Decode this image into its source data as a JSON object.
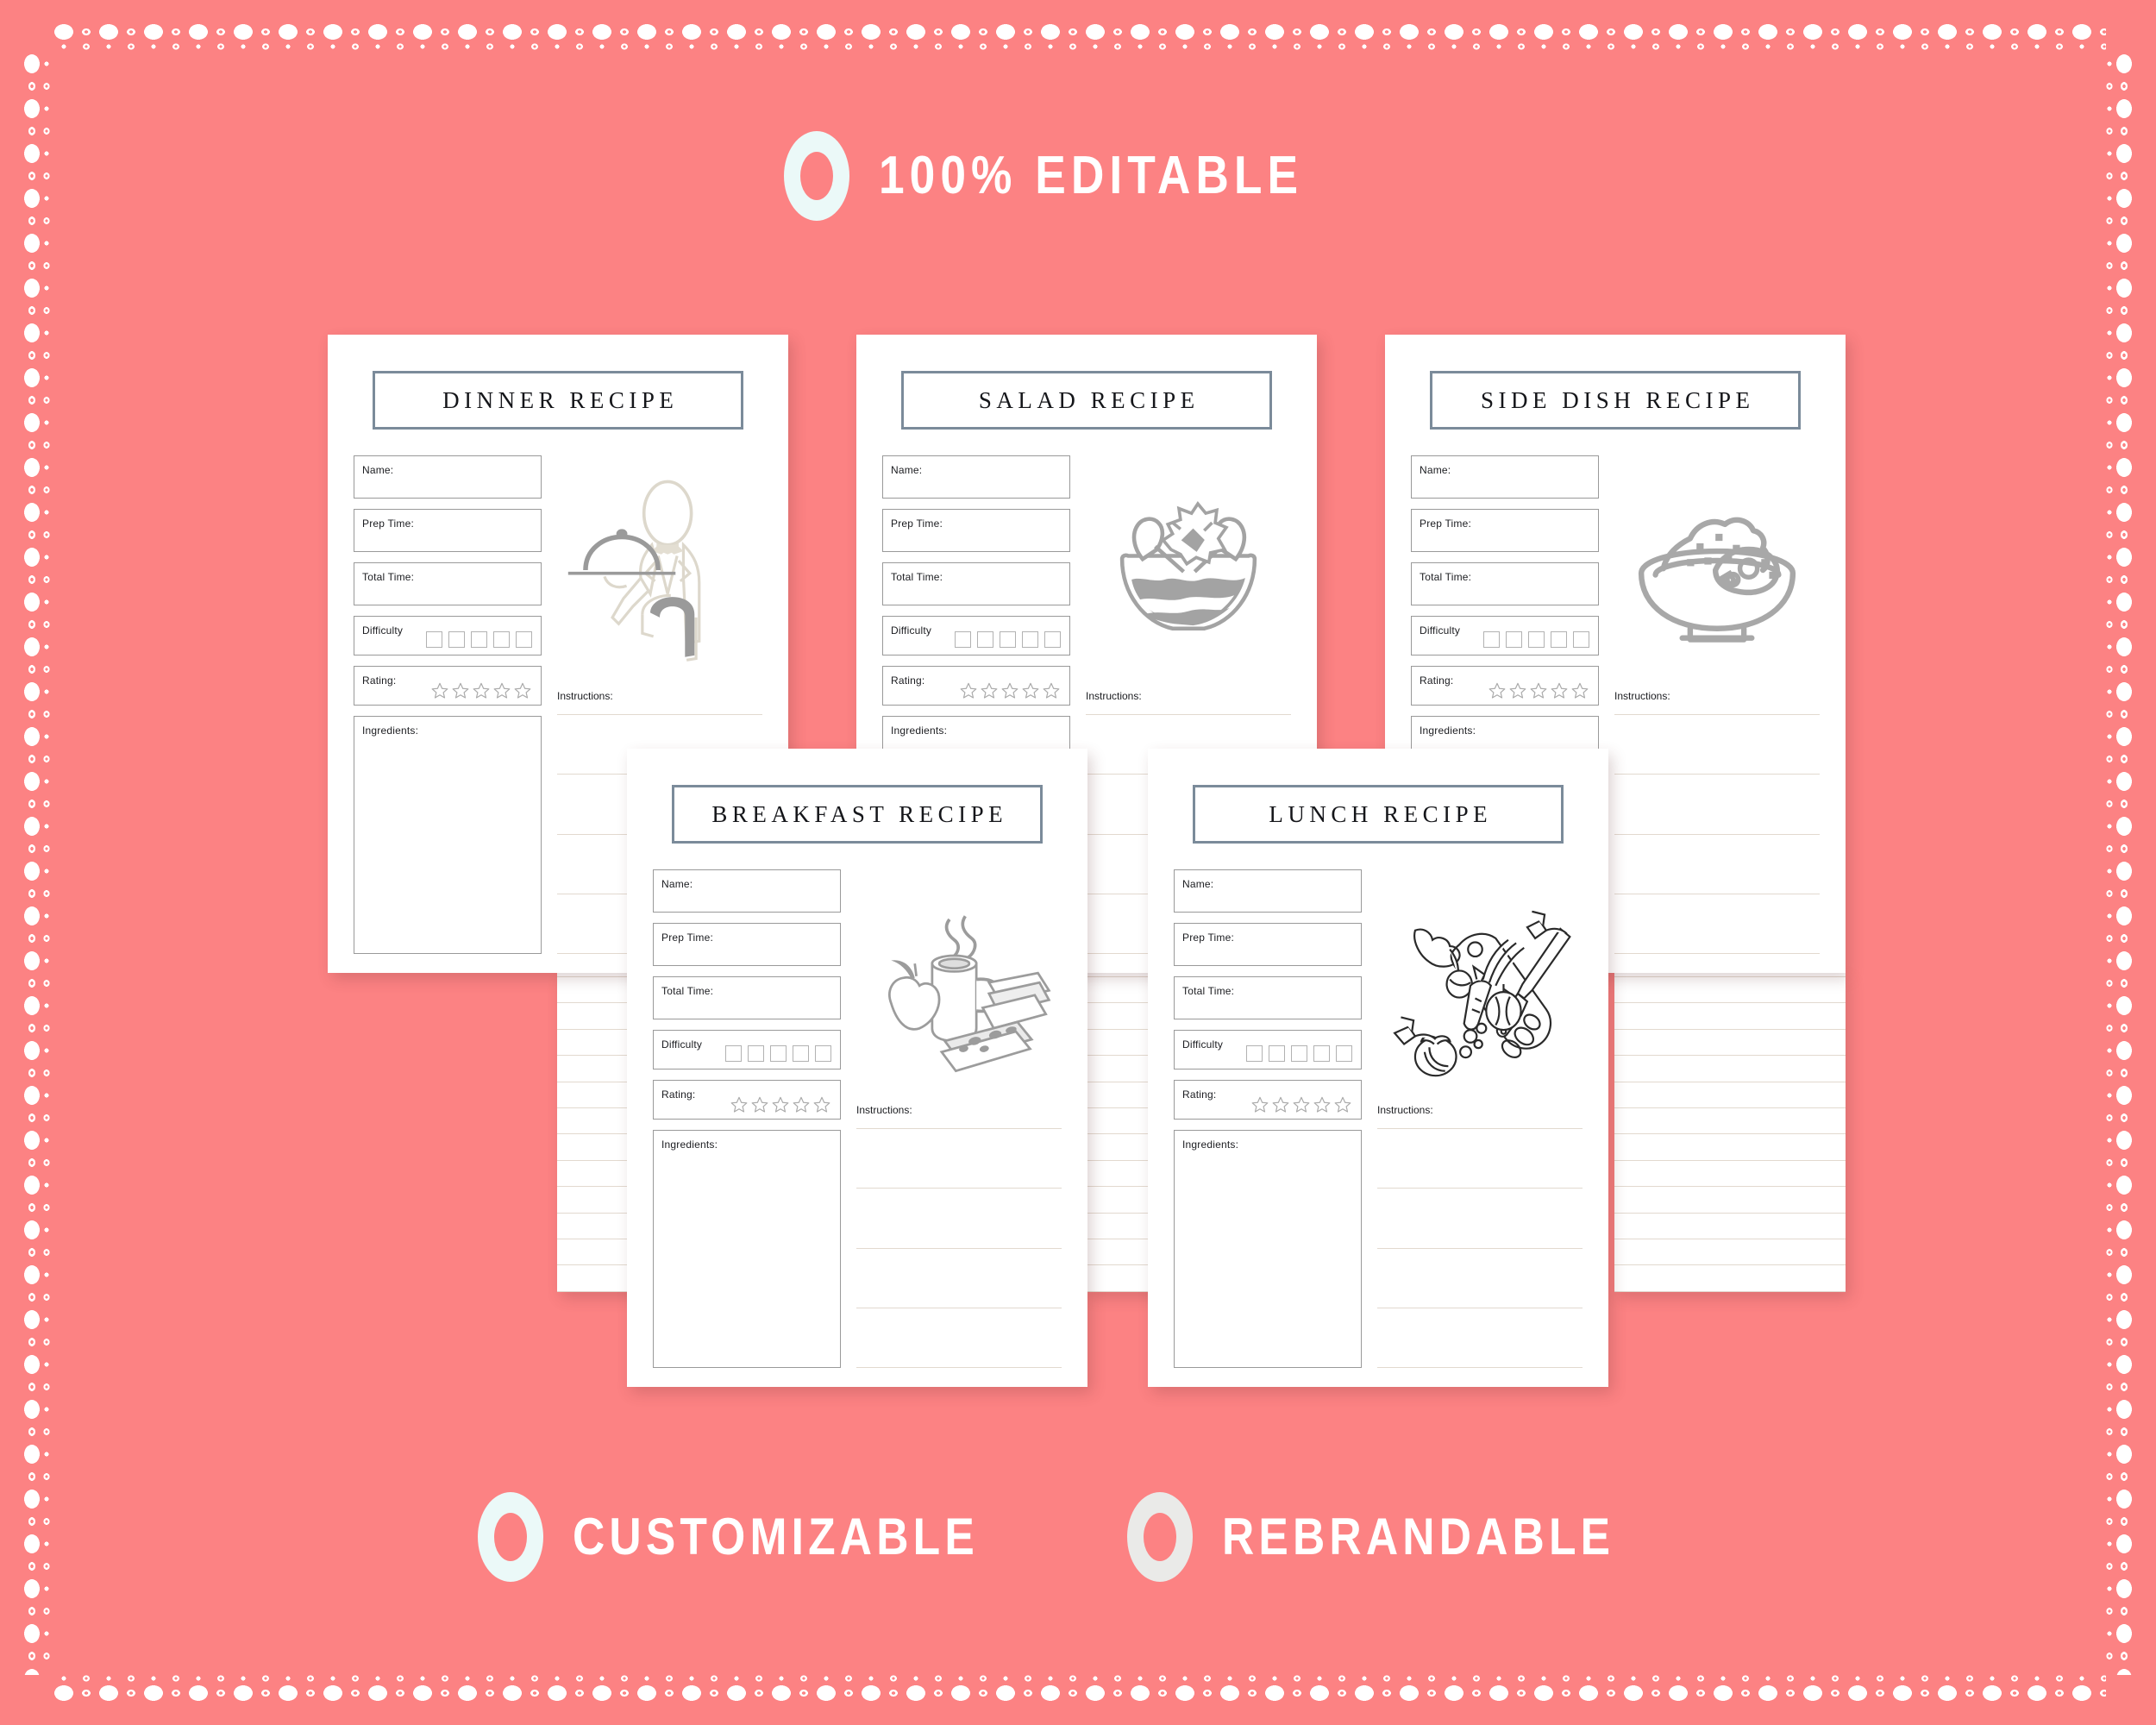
{
  "background_color": "#fc8283",
  "header": {
    "badge": {
      "icon": "ring-icon",
      "ring_color": "#ebf9f8"
    },
    "title": "100% EDITABLE"
  },
  "footer": {
    "badges": [
      {
        "icon": "ring-icon",
        "ring_color": "#ebf9f8",
        "label": "CUSTOMIZABLE"
      },
      {
        "icon": "ring-icon",
        "ring_color": "#eaeae8",
        "label": "REBRANDABLE"
      }
    ]
  },
  "field_labels": {
    "name": "Name:",
    "prep_time": "Prep Time:",
    "total_time": "Total Time:",
    "difficulty": "Difficulty",
    "rating": "Rating:",
    "ingredients": "Ingredients:",
    "instructions": "Instructions:"
  },
  "controls": {
    "difficulty_boxes": 5,
    "rating_stars": 5,
    "instruction_lines": 5,
    "instruction_spill_lines": 13
  },
  "title_border_color": "#7b8b9a",
  "cards": [
    {
      "id": "dinner",
      "title": "DINNER RECIPE",
      "illustration": "waiter-with-tray-icon"
    },
    {
      "id": "salad",
      "title": "SALAD RECIPE",
      "illustration": "salad-bowl-icon"
    },
    {
      "id": "sidedish",
      "title": "SIDE DISH RECIPE",
      "illustration": "rice-bowl-icon"
    },
    {
      "id": "breakfast",
      "title": "BREAKFAST RECIPE",
      "illustration": "coffee-breakfast-icon"
    },
    {
      "id": "lunch",
      "title": "LUNCH RECIPE",
      "illustration": "cutting-board-vegetables-icon"
    }
  ]
}
